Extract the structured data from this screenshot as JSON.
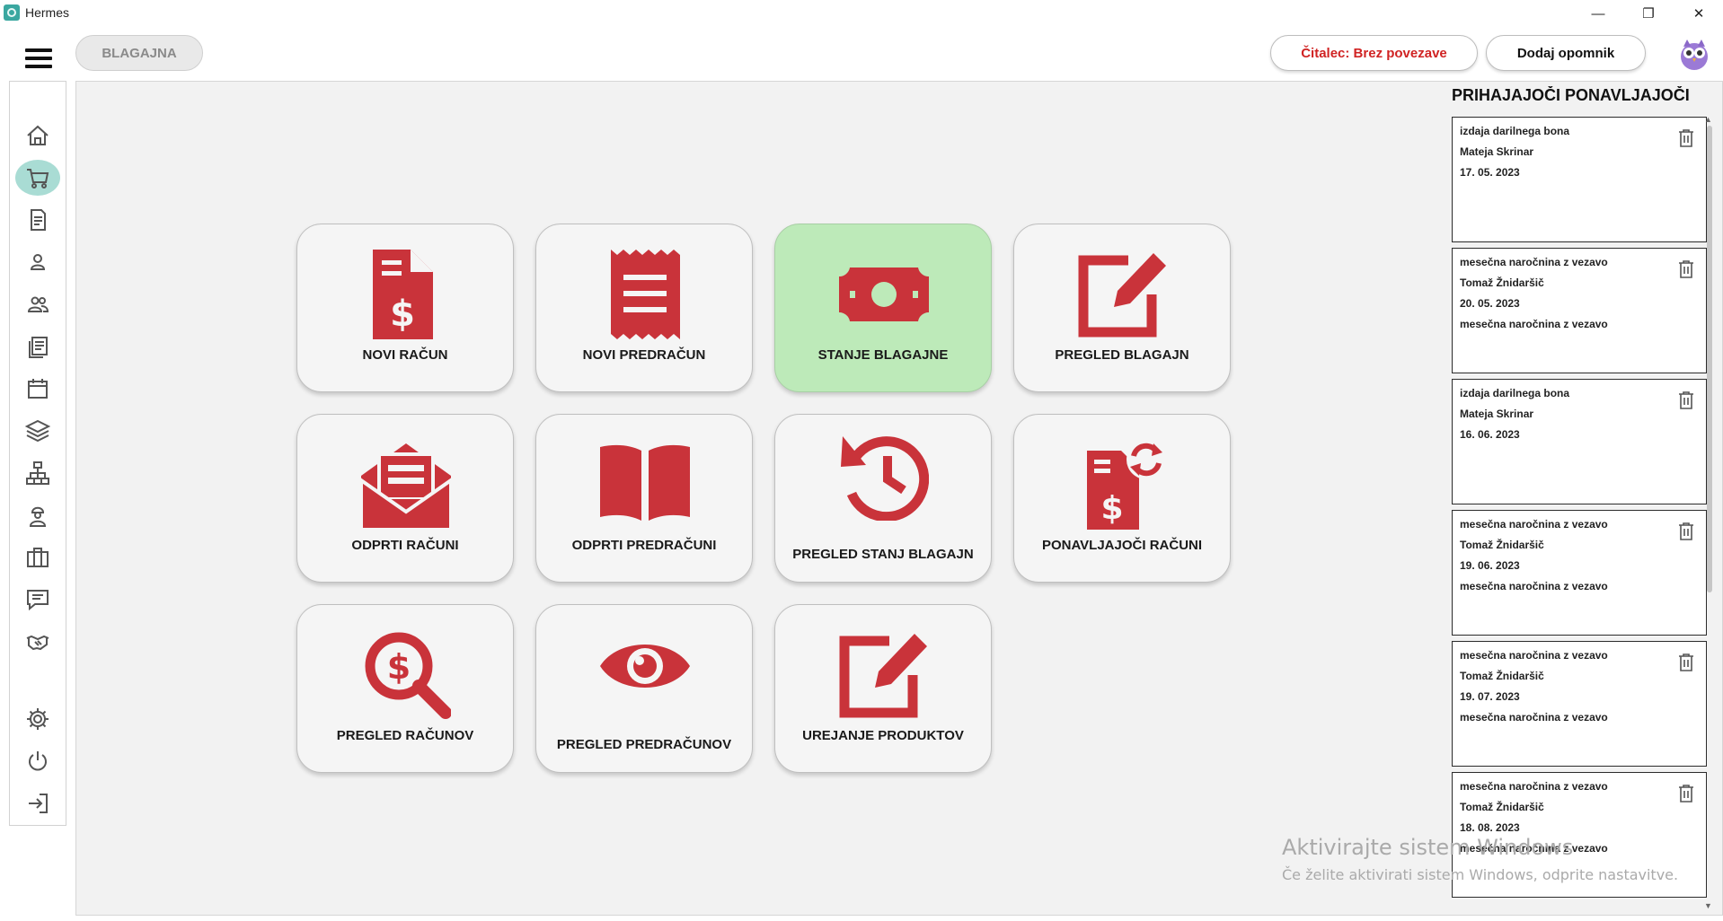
{
  "window": {
    "title": "Hermes",
    "minimize": "—",
    "maximize": "❐",
    "close": "✕"
  },
  "header": {
    "module": "BLAGAJNA",
    "reader_button": "Čitalec: Brez povezave",
    "reminder_button": "Dodaj opomnik"
  },
  "sidebar": {
    "items": [
      {
        "icon": "home-icon",
        "active": false
      },
      {
        "icon": "cart-icon",
        "active": true
      },
      {
        "icon": "document-icon",
        "active": false
      },
      {
        "icon": "user-icon",
        "active": false
      },
      {
        "icon": "users-icon",
        "active": false
      },
      {
        "icon": "notes-icon",
        "active": false
      },
      {
        "icon": "calendar-icon",
        "active": false
      },
      {
        "icon": "layers-icon",
        "active": false
      },
      {
        "icon": "sitemap-icon",
        "active": false
      },
      {
        "icon": "worker-icon",
        "active": false
      },
      {
        "icon": "briefcase-icon",
        "active": false
      },
      {
        "icon": "chat-icon",
        "active": false
      },
      {
        "icon": "handshake-icon",
        "active": false
      },
      {
        "icon": "gear-icon",
        "active": false
      },
      {
        "icon": "power-icon",
        "active": false
      },
      {
        "icon": "logout-icon",
        "active": false
      }
    ]
  },
  "tiles": [
    {
      "label": "NOVI RAČUN",
      "icon": "invoice-dollar-icon",
      "active": false
    },
    {
      "label": "NOVI PREDRAČUN",
      "icon": "receipt-icon",
      "active": false
    },
    {
      "label": "STANJE BLAGAJNE",
      "icon": "money-bill-icon",
      "active": true
    },
    {
      "label": "PREGLED BLAGAJN",
      "icon": "edit-icon",
      "active": false
    },
    {
      "label": "ODPRTI RAČUNI",
      "icon": "envelope-open-icon",
      "active": false
    },
    {
      "label": "ODPRTI PREDRAČUNI",
      "icon": "book-open-icon",
      "active": false
    },
    {
      "label": "PREGLED STANJ BLAGAJN",
      "icon": "history-icon",
      "active": false
    },
    {
      "label": "PONAVLJAJOČI RAČUNI",
      "icon": "recurring-invoice-icon",
      "active": false
    },
    {
      "label": "PREGLED RAČUNOV",
      "icon": "search-dollar-icon",
      "active": false
    },
    {
      "label": "PREGLED PREDRAČUNOV",
      "icon": "eye-icon",
      "active": false
    },
    {
      "label": "UREJANJE PRODUKTOV",
      "icon": "edit-icon",
      "active": false
    }
  ],
  "right_panel": {
    "title": "PRIHAJAJOČI PONAVLJAJOČI ...",
    "cards": [
      {
        "lines": [
          "izdaja darilnega bona",
          "Mateja Skrinar",
          "17. 05. 2023"
        ]
      },
      {
        "lines": [
          "mesečna naročnina z vezavo",
          "Tomaž Žnidaršič",
          "20. 05. 2023",
          "mesečna naročnina z vezavo"
        ]
      },
      {
        "lines": [
          "izdaja darilnega bona",
          "Mateja Skrinar",
          "16. 06. 2023"
        ]
      },
      {
        "lines": [
          "mesečna naročnina z vezavo",
          "Tomaž Žnidaršič",
          "19. 06. 2023",
          "mesečna naročnina z vezavo"
        ]
      },
      {
        "lines": [
          "mesečna naročnina z vezavo",
          "Tomaž Žnidaršič",
          "19. 07. 2023",
          "mesečna naročnina z vezavo"
        ]
      },
      {
        "lines": [
          "mesečna naročnina z vezavo",
          "Tomaž Žnidaršič",
          "18. 08. 2023",
          "mesečna naročnina z vezavo"
        ]
      }
    ]
  },
  "watermark": {
    "line1": "Aktivirajte sistem Windows",
    "line2": "Če želite aktivirati sistem Windows, odprite nastavitve."
  },
  "colors": {
    "accent_red": "#c9333a",
    "active_tile": "#bdeab9",
    "sidebar_active": "#a9dcd4"
  }
}
